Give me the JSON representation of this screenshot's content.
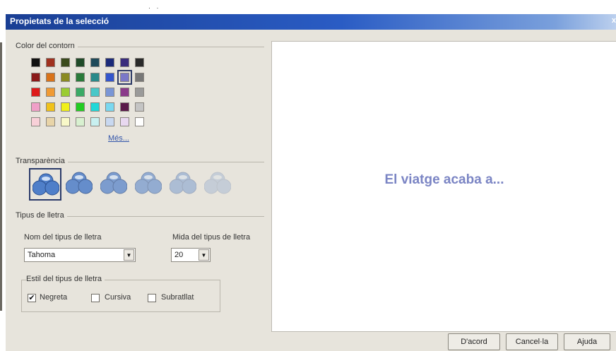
{
  "window": {
    "title": "Propietats de la selecció"
  },
  "outline_color": {
    "label": "Color del contorn",
    "more_link": "Més...",
    "selected": {
      "row": 1,
      "col": 6
    },
    "rows": [
      [
        "#111111",
        "#a0311f",
        "#3a4a1c",
        "#1f4a28",
        "#1f4a5a",
        "#1c2b7a",
        "#3a2d7d",
        "#2a2a2a"
      ],
      [
        "#8a1a1a",
        "#d9731a",
        "#8a8a22",
        "#2a7a3a",
        "#2a8a8a",
        "#3355cc",
        "#7a78c8",
        "#777777"
      ],
      [
        "#dd1a1a",
        "#f09a33",
        "#9acc33",
        "#3aaa66",
        "#4ac8c8",
        "#7a96d6",
        "#8a3a8a",
        "#9a9a9a"
      ],
      [
        "#f0a0c8",
        "#f0c21a",
        "#f0f01a",
        "#22cc22",
        "#22d8d8",
        "#7ad8f0",
        "#5a1a4a",
        "#c4c4c4"
      ],
      [
        "#f8d0d8",
        "#e8d4a8",
        "#f8f8c8",
        "#d8f0d0",
        "#c8f0f0",
        "#c8d8f0",
        "#e8d8f0",
        "#ffffff"
      ]
    ]
  },
  "transparency": {
    "label": "Transparència",
    "selected_index": 0,
    "levels": [
      1.0,
      0.85,
      0.7,
      0.55,
      0.38,
      0.22
    ]
  },
  "font": {
    "group_label": "Tipus de lletra",
    "name_label": "Nom del tipus de lletra",
    "name_value": "Tahoma",
    "size_label": "Mida del tipus de lletra",
    "size_value": "20",
    "style_label": "Estil del tipus de lletra",
    "bold_label": "Negreta",
    "bold_checked": true,
    "bold_check_mark": "✔",
    "italic_label": "Cursiva",
    "italic_checked": false,
    "underline_label": "Subratllat",
    "underline_checked": false
  },
  "preview": {
    "text": "El viatge acaba a..."
  },
  "buttons": {
    "ok": "D'acord",
    "cancel": "Cancel·la",
    "help": "Ajuda"
  }
}
